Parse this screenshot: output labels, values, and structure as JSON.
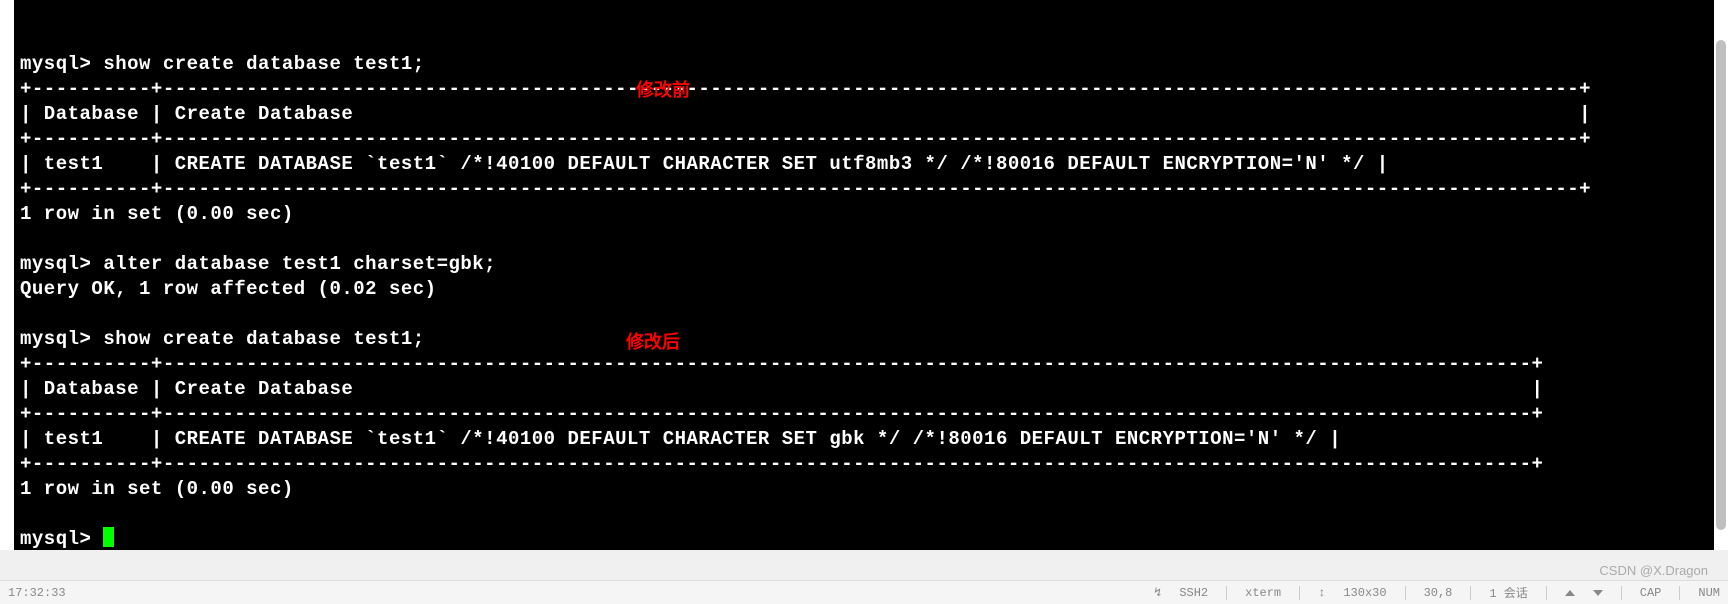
{
  "terminal": {
    "line0": "",
    "cmd1": "mysql> show create database test1;",
    "table1_top": "+----------+-----------------------------------------------------------------------------------------------------------------------+",
    "table1_header": "| Database | Create Database                                                                                                       |",
    "table1_mid": "+----------+-----------------------------------------------------------------------------------------------------------------------+",
    "table1_row": "| test1    | CREATE DATABASE `test1` /*!40100 DEFAULT CHARACTER SET utf8mb3 */ /*!80016 DEFAULT ENCRYPTION='N' */ |",
    "table1_bot": "+----------+-----------------------------------------------------------------------------------------------------------------------+",
    "result1": "1 row in set (0.00 sec)",
    "blank1": "",
    "cmd2": "mysql> alter database test1 charset=gbk;",
    "result2": "Query OK, 1 row affected (0.02 sec)",
    "blank2": "",
    "cmd3": "mysql> show create database test1;",
    "table2_top": "+----------+-------------------------------------------------------------------------------------------------------------------+",
    "table2_header": "| Database | Create Database                                                                                                   |",
    "table2_mid": "+----------+-------------------------------------------------------------------------------------------------------------------+",
    "table2_row": "| test1    | CREATE DATABASE `test1` /*!40100 DEFAULT CHARACTER SET gbk */ /*!80016 DEFAULT ENCRYPTION='N' */ |",
    "table2_bot": "+----------+-------------------------------------------------------------------------------------------------------------------+",
    "result3": "1 row in set (0.00 sec)",
    "blank3": "",
    "prompt_final": "mysql> "
  },
  "annotations": {
    "before": "修改前",
    "after": "修改后"
  },
  "watermark": "CSDN @X.Dragon",
  "statusbar": {
    "time": "17:32:33",
    "proto": "SSH2",
    "proto_label": "ssh2:",
    "term": "xterm",
    "size": "130x30",
    "pos": "30,8",
    "session": "1 会话",
    "cap": "CAP",
    "num": "NUM"
  }
}
